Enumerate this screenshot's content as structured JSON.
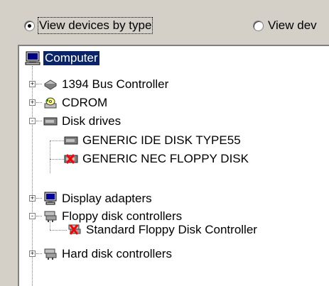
{
  "view_options": {
    "by_type_label": "View devices by type",
    "by_connection_label": "View dev",
    "selected": "by_type"
  },
  "tree": {
    "root": {
      "label": "Computer",
      "icon": "computer-icon",
      "selected": true
    },
    "items": [
      {
        "label": "1394 Bus Controller",
        "icon": "bus-controller-icon",
        "expander": "+"
      },
      {
        "label": "CDROM",
        "icon": "cdrom-icon",
        "expander": "+"
      },
      {
        "label": "Disk drives",
        "icon": "disk-drive-icon",
        "expander": "-"
      },
      {
        "label": "GENERIC IDE  DISK TYPE55",
        "icon": "disk-drive-icon"
      },
      {
        "label": "GENERIC NEC  FLOPPY DISK",
        "icon": "disabled-disk-icon"
      },
      {
        "label": "Display adapters",
        "icon": "monitor-icon",
        "expander": "+"
      },
      {
        "label": "Floppy disk controllers",
        "icon": "controller-icon",
        "expander": "-"
      },
      {
        "label": "Standard Floppy Disk Controller",
        "icon": "disabled-controller-icon"
      },
      {
        "label": "Hard disk controllers",
        "icon": "controller-icon",
        "expander": "+"
      }
    ]
  },
  "colors": {
    "selection": "#0a246a",
    "window": "#d4d0c8",
    "error": "#ff0000"
  }
}
